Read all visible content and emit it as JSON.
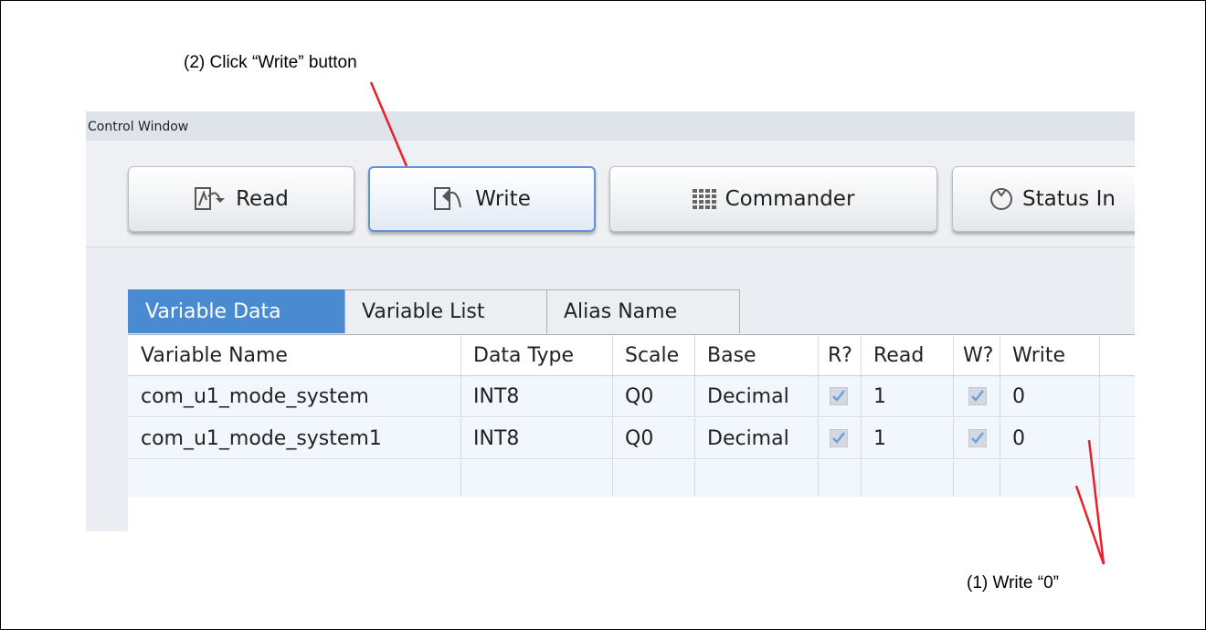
{
  "annotations": {
    "step2": "(2) Click “Write” button",
    "step1": "(1) Write “0”"
  },
  "window": {
    "title": "Control Window"
  },
  "toolbar": {
    "buttons": [
      {
        "label": "Read",
        "icon": "read-icon"
      },
      {
        "label": "Write",
        "icon": "write-icon",
        "active": true
      },
      {
        "label": "Commander",
        "icon": "commander-grid-icon"
      },
      {
        "label": "Status In",
        "icon": "status-circle-icon"
      }
    ]
  },
  "tabs": [
    {
      "label": "Variable Data",
      "selected": true
    },
    {
      "label": "Variable List"
    },
    {
      "label": "Alias Name"
    }
  ],
  "table": {
    "columns": [
      "Variable Name",
      "Data Type",
      "Scale",
      "Base",
      "R?",
      "Read",
      "W?",
      "Write"
    ],
    "rows": [
      {
        "name": "com_u1_mode_system",
        "type": "INT8",
        "scale": "Q0",
        "base": "Decimal",
        "r": true,
        "read": "1",
        "w": true,
        "write": "0"
      },
      {
        "name": "com_u1_mode_system1",
        "type": "INT8",
        "scale": "Q0",
        "base": "Decimal",
        "r": true,
        "read": "1",
        "w": true,
        "write": "0"
      }
    ]
  },
  "colors": {
    "annotation_line": "#e8202a",
    "tab_selected": "#4a8ad1",
    "button_active_border": "#5e94d8",
    "checkmark": "#6d9ee0"
  }
}
